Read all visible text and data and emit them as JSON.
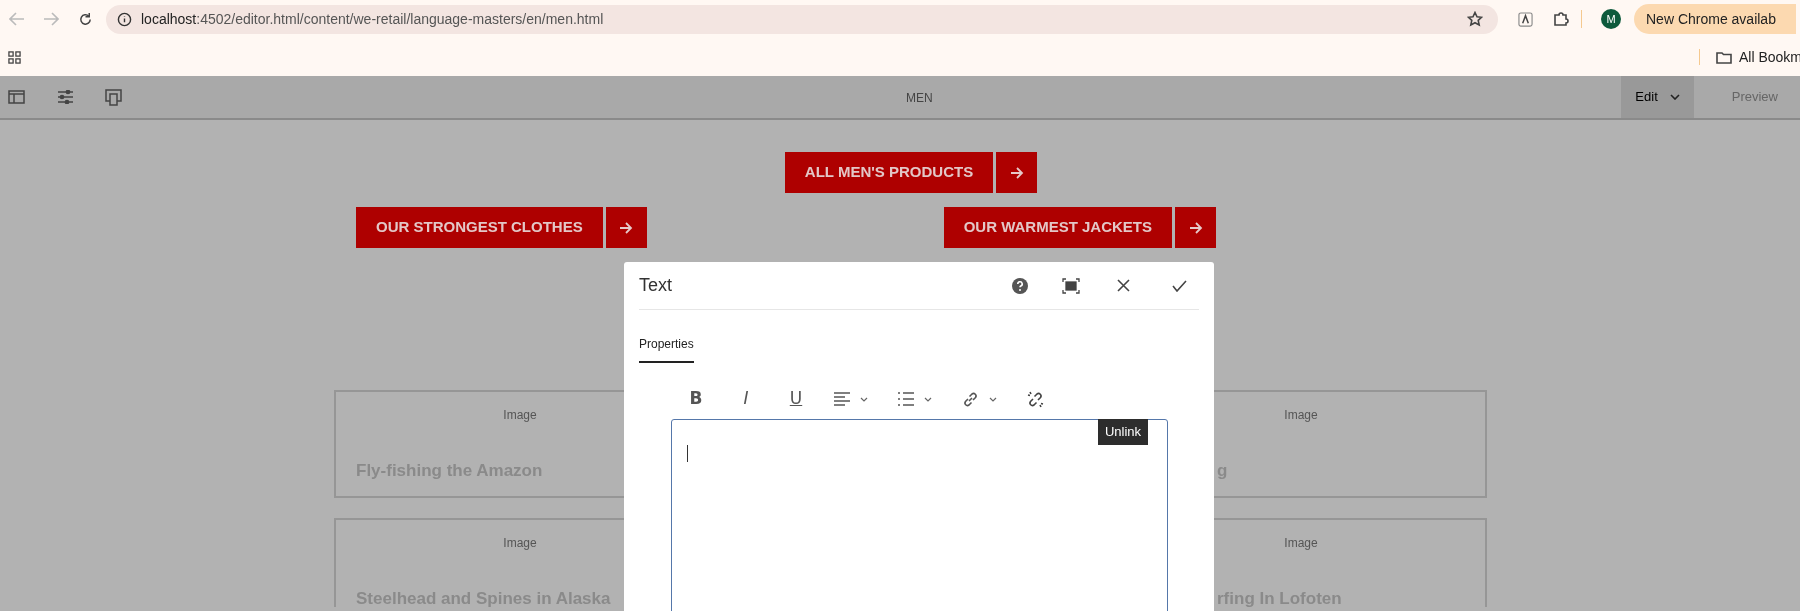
{
  "browser": {
    "url_host": "localhost",
    "url_path": ":4502/editor.html/content/we-retail/language-masters/en/men.html",
    "avatar": "M",
    "update_pill": "New Chrome availab",
    "bookmark": "All Bookm"
  },
  "editor_toolbar": {
    "page_title": "MEN",
    "modes": [
      {
        "label": "Edit",
        "selected": true
      },
      {
        "label": "Preview",
        "selected": false
      }
    ]
  },
  "page": {
    "top_button": "ALL MEN'S PRODUCTS",
    "buttons": [
      "OUR STRONGEST CLOTHES",
      "OUR WARMEST JACKETS"
    ],
    "cards": [
      {
        "left": {
          "image_label": "Image",
          "title": "Fly-fishing the Amazon"
        },
        "right": {
          "image_label": "Image",
          "title": "g"
        }
      },
      {
        "left": {
          "image_label": "Image",
          "title": "Steelhead and Spines in Alaska"
        },
        "right": {
          "image_label": "Image",
          "title": "rfing In Lofoten"
        }
      }
    ]
  },
  "dialog": {
    "title": "Text",
    "tabs": [
      {
        "label": "Properties",
        "selected": true
      }
    ],
    "format_buttons": [
      "B",
      "I",
      "U"
    ],
    "tooltip": "Unlink"
  }
}
